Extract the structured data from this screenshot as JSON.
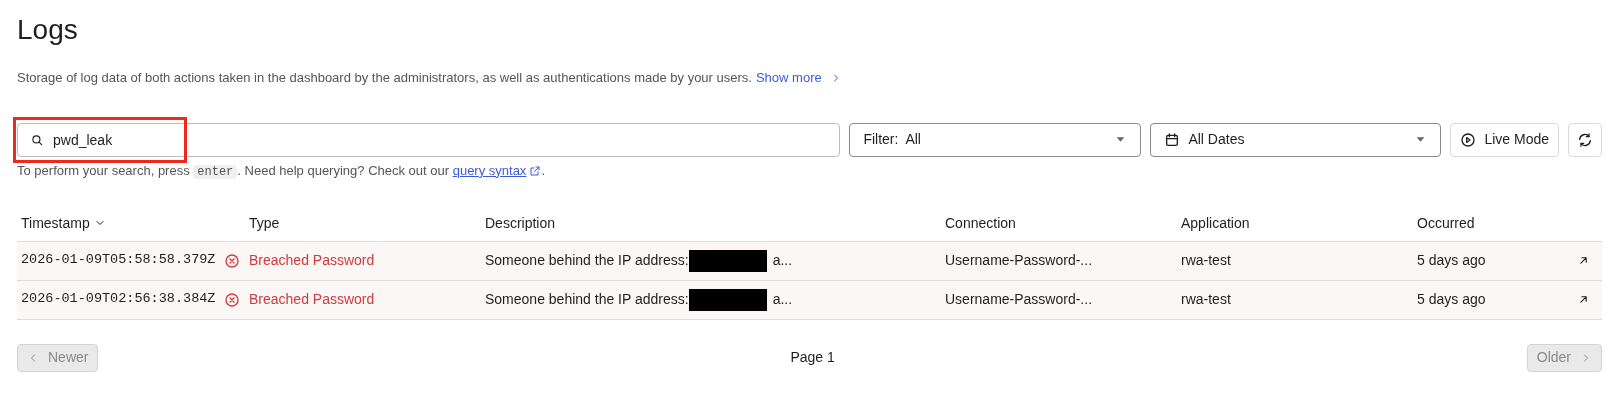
{
  "page": {
    "title": "Logs",
    "description": "Storage of log data of both actions taken in the dashboard by the administrators, as well as authentications made by your users.",
    "show_more": "Show more"
  },
  "search": {
    "value": "pwd_leak",
    "highlighted": true
  },
  "filter": {
    "label": "Filter:",
    "value": "All"
  },
  "dates": {
    "value": "All Dates"
  },
  "live_mode": {
    "label": "Live Mode"
  },
  "hint": {
    "before": "To perform your search, press",
    "key": "enter",
    "middle": ". Need help querying? Check out our",
    "link": "query syntax",
    "after": "."
  },
  "table": {
    "columns": [
      {
        "label": "Timestamp",
        "sorted": true
      },
      {
        "label": "Type",
        "sorted": false
      },
      {
        "label": "Description",
        "sorted": false
      },
      {
        "label": "Connection",
        "sorted": false
      },
      {
        "label": "Application",
        "sorted": false
      },
      {
        "label": "Occurred",
        "sorted": false
      }
    ],
    "rows": [
      {
        "timestamp": "2026-01-09T05:58:58.379Z",
        "kind": "error",
        "type": "Breached Password",
        "description": "Someone behind the IP address:",
        "redacted": true,
        "description_end": "a...",
        "connection": "Username-Password-...",
        "application": "rwa-test",
        "occurred": "5 days ago"
      },
      {
        "timestamp": "2026-01-09T02:56:38.384Z",
        "kind": "error",
        "type": "Breached Password",
        "description": "Someone behind the IP address:",
        "redacted": true,
        "description_end": "a...",
        "connection": "Username-Password-...",
        "application": "rwa-test",
        "occurred": "5 days ago"
      }
    ]
  },
  "pagination": {
    "newer": {
      "label": "Newer",
      "disabled": true
    },
    "page": "Page 1",
    "older": {
      "label": "Older",
      "disabled": true
    }
  }
}
